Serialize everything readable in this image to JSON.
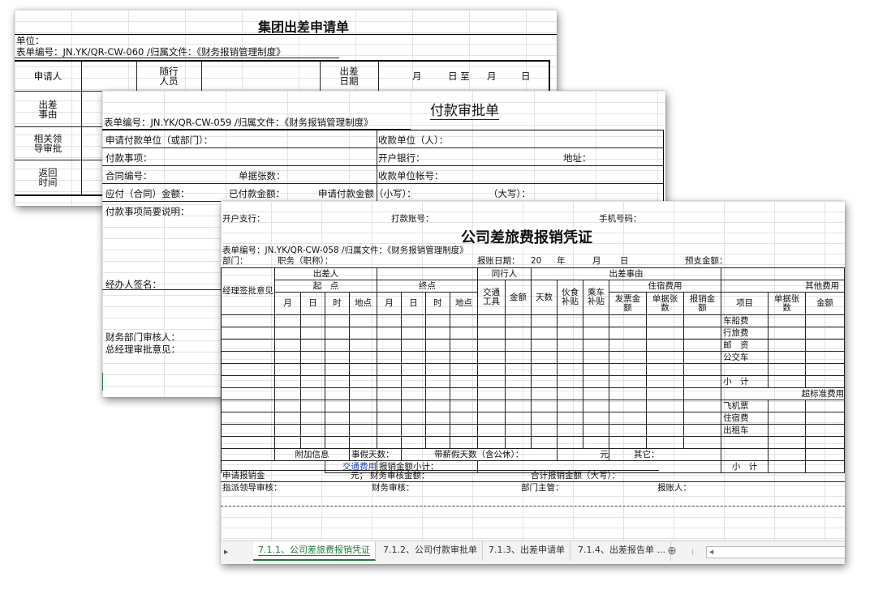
{
  "sheet1": {
    "title": "集团出差申请单",
    "unit_label": "单位：",
    "form_no": "表单编号：JN.YK/QR-CW-060 /归属文件：《财务报销管理制度》",
    "applicant": "申请人",
    "companion": "随行\n人员",
    "trip_date": "出差\n日期",
    "month1": "月",
    "day_to": "日 至",
    "month2": "月",
    "day2": "日",
    "trip_reason": "出差\n事由",
    "leader_approval": "相关领\n导审批",
    "return_time": "返回\n时间"
  },
  "sheet2": {
    "title": "付款审批单",
    "form_no": "表单编号：JN.YK/QR-CW-059 /归属文件：《财务报销管理制度》",
    "apply_unit": "申请付款单位（或部门）：",
    "payee_unit": "收款单位（人）：",
    "pay_item": "付款事项：",
    "bank": "开户银行：",
    "address": "地址：",
    "contract_no": "合同编号：",
    "doc_count": "单据张数：",
    "payee_account": "收款单位帐号：",
    "payable": "应付（合同）金额：",
    "paid": "已付款金额：",
    "apply_amount_small": "申请付款金额（小写）：",
    "amount_big": "（大写）：",
    "summary": "付款事项简要说明：",
    "handler_sign": "经办人签名：",
    "finance_reviewer": "财务部门审核人：",
    "gm_opinion": "总经理审批意见："
  },
  "sheet3": {
    "top_bank_branch": "开户支行：",
    "top_account": "打款账号：",
    "top_phone": "手机号码：",
    "title": "公司差旅费报销凭证",
    "form_no": "表单编号：JN.YK/QR-CW-058 /归属文件：《财务报销管理制度》",
    "dept": "部门：",
    "position": "职务（职称）：",
    "report_date": "报账日期：",
    "year_prefix": "20",
    "year": "年",
    "month": "月",
    "day": "日",
    "prepay": "预支金额：",
    "h_manager": "经理签批意见",
    "h_traveler": "出差人",
    "h_start": "起　点",
    "h_end": "终点",
    "h_companion": "同行人",
    "h_reason": "出差事由",
    "h_transport": "交通\n工具",
    "h_amount": "金额",
    "h_days": "天数",
    "h_meal": "伙食\n补贴",
    "h_ride": "乘车\n补贴",
    "h_lodging": "住宿费用",
    "h_invoice": "发票金\n额",
    "h_docs": "单据张\n数",
    "h_reimb": "报销金\n额",
    "h_other": "其他费用",
    "h_item": "项目",
    "h_other_docs": "单据张\n数",
    "h_other_amount": "金额",
    "col_month": "月",
    "col_day": "日",
    "col_hour": "时",
    "col_place": "地点",
    "other_items": [
      "车船费",
      "行旅费",
      "邮　资",
      "公交车",
      "",
      "小　计",
      "超标准费用",
      "飞机票",
      "住宿费",
      "出租车"
    ],
    "attach": "附加信息",
    "leave_days": "事假天数：",
    "paid_leave": "带薪假天数（含公休）：",
    "yuan": "元",
    "other": "其它：",
    "traffic_fee": "交通费用",
    "reimb_subtotal": "报销金额小计：",
    "subtotal": "小　计",
    "apply_reimb": "申请报销金",
    "yuan2": "元；",
    "finance_amount": "财务审核金额：",
    "total_big": "合计报销金额（大写）：",
    "assign_leader": "指派领导审核：",
    "finance_review": "财务审核：",
    "dept_head": "部门主管：",
    "reporter": "报账人："
  },
  "tabs": {
    "arrow": "▸",
    "items": [
      "7.1.1、公司差旅费报销凭证",
      "7.1.2、公司付款审批单",
      "7.1.3、出差申请单",
      "7.1.4、出差报告单 ..."
    ],
    "add": "⊕",
    "sep": "⁝",
    "scroll": "◂"
  }
}
